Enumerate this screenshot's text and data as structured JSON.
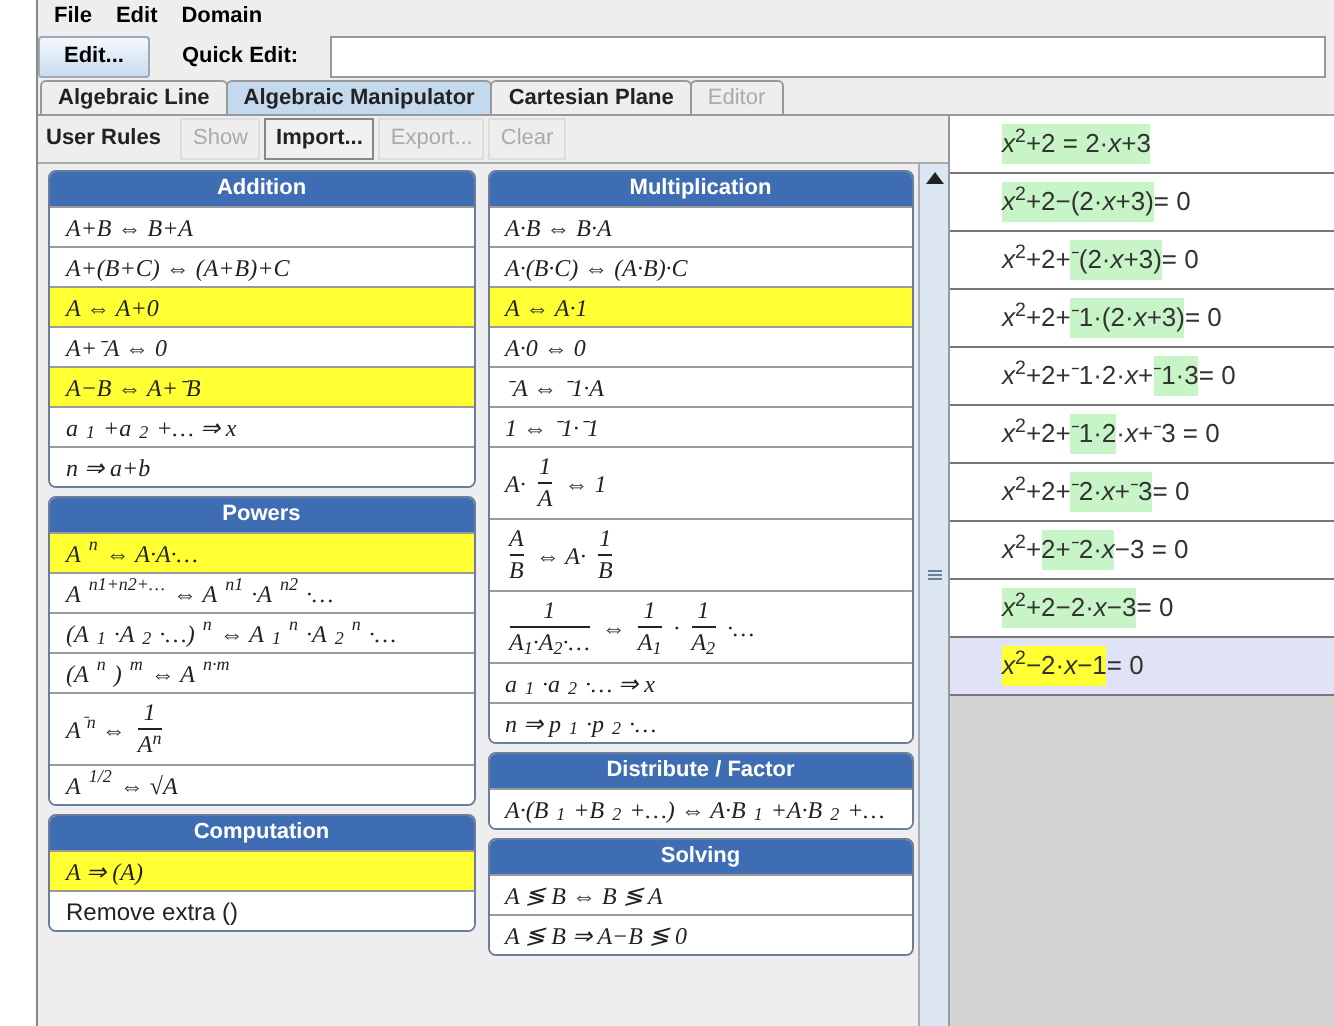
{
  "menu": [
    "File",
    "Edit",
    "Domain"
  ],
  "toolbar": {
    "edit_button": "Edit...",
    "quick_edit_label": "Quick Edit:"
  },
  "tabs": [
    {
      "label": "Algebraic Line",
      "selected": false,
      "disabled": false
    },
    {
      "label": "Algebraic Manipulator",
      "selected": true,
      "disabled": false
    },
    {
      "label": "Cartesian Plane",
      "selected": false,
      "disabled": false
    },
    {
      "label": "Editor",
      "selected": false,
      "disabled": true
    }
  ],
  "rules_toolbar": {
    "label": "User Rules",
    "buttons": [
      {
        "label": "Show",
        "disabled": true
      },
      {
        "label": "Import...",
        "disabled": false
      },
      {
        "label": "Export...",
        "disabled": true
      },
      {
        "label": "Clear",
        "disabled": true
      }
    ]
  },
  "columns": [
    [
      {
        "title": "Addition",
        "rules": [
          {
            "text": "A+B ⇔ B+A",
            "highlighted": false
          },
          {
            "text": "A+(B+C) ⇔ (A+B)+C",
            "highlighted": false
          },
          {
            "text": "A ⇔ A+0",
            "highlighted": true
          },
          {
            "text": "A+⁻A ⇔ 0",
            "highlighted": false
          },
          {
            "text": "A−B ⇔ A+⁻B",
            "highlighted": true
          },
          {
            "text": "a$_{1}$+a$_{2}$+… ⇒ x",
            "highlighted": false
          },
          {
            "text": "n ⇒ a+b",
            "highlighted": false
          }
        ]
      },
      {
        "title": "Powers",
        "rules": [
          {
            "text": "A$^{n}$ ⇔ A·A·…",
            "highlighted": true
          },
          {
            "text": "A$^{n1+n2+…}$ ⇔ A$^{n1}$·A$^{n2}$·…",
            "highlighted": false
          },
          {
            "text": "(A$_{1}$·A$_{2}$·…)$^{n}$ ⇔ A$_{1}$$^{n}$·A$_{2}$$^{n}$·…",
            "highlighted": false
          },
          {
            "text": "(A$^{n}$)$^{m}$ ⇔ A$^{n·m}$",
            "highlighted": false
          },
          {
            "parts": [
              {
                "kind": "text",
                "text": "A$^{⁻n}$ ⇔"
              },
              {
                "kind": "fraction",
                "num": "1",
                "den": "A$^{n}$"
              }
            ],
            "highlighted": false
          },
          {
            "text": "A$^{1/2}$ ⇔ √A",
            "highlighted": false
          }
        ]
      },
      {
        "title": "Computation",
        "rules": [
          {
            "text": "A ⇒ (A)",
            "highlighted": true
          },
          {
            "text": "Remove extra ()",
            "highlighted": false,
            "plain": true
          }
        ]
      }
    ],
    [
      {
        "title": "Multiplication",
        "rules": [
          {
            "text": "A·B ⇔ B·A",
            "highlighted": false
          },
          {
            "text": "A·(B·C) ⇔ (A·B)·C",
            "highlighted": false
          },
          {
            "text": "A ⇔ A·1",
            "highlighted": true
          },
          {
            "text": "A·0 ⇔ 0",
            "highlighted": false
          },
          {
            "text": "⁻A ⇔ ⁻1·A",
            "highlighted": false
          },
          {
            "text": "1 ⇔ ⁻1·⁻1",
            "highlighted": false
          },
          {
            "parts": [
              {
                "kind": "text",
                "text": "A·"
              },
              {
                "kind": "fraction",
                "num": "1",
                "den": "A"
              },
              {
                "kind": "text",
                "text": "⇔ 1"
              }
            ],
            "highlighted": false
          },
          {
            "parts": [
              {
                "kind": "fraction",
                "num": "A",
                "den": "B"
              },
              {
                "kind": "text",
                "text": "⇔ A·"
              },
              {
                "kind": "fraction",
                "num": "1",
                "den": "B"
              }
            ],
            "highlighted": false
          },
          {
            "parts": [
              {
                "kind": "fraction",
                "num": "1",
                "den": "A$_{1}$·A$_{2}$·…"
              },
              {
                "kind": "text",
                "text": "⇔"
              },
              {
                "kind": "fraction",
                "num": "1",
                "den": "A$_{1}$"
              },
              {
                "kind": "text",
                "text": "·"
              },
              {
                "kind": "fraction",
                "num": "1",
                "den": "A$_{2}$"
              },
              {
                "kind": "text",
                "text": "·…"
              }
            ],
            "highlighted": false
          },
          {
            "text": "a$_{1}$·a$_{2}$·… ⇒ x",
            "highlighted": false
          },
          {
            "text": "n ⇒ p$_{1}$·p$_{2}$·…",
            "highlighted": false
          }
        ]
      },
      {
        "title": "Distribute / Factor",
        "rules": [
          {
            "text": "A·(B$_{1}$+B$_{2}$+…) ⇔ A·B$_{1}$+A·B$_{2}$+…",
            "highlighted": false
          }
        ]
      },
      {
        "title": "Solving",
        "rules": [
          {
            "text": "A ≶ B ⇔ B ≶ A",
            "highlighted": false
          },
          {
            "text": "A ≶ B ⇒ A−B ≶ 0",
            "highlighted": false
          }
        ]
      }
    ]
  ],
  "steps": [
    {
      "selected": false,
      "segments": [
        {
          "text": "*x*$^{2}$+2 = 2·*x*+3",
          "highlighted": true
        }
      ]
    },
    {
      "selected": false,
      "segments": [
        {
          "text": "*x*$^{2}$+2−(2·*x*+3)",
          "highlighted": true
        },
        {
          "text": " = 0",
          "highlighted": false
        }
      ]
    },
    {
      "selected": false,
      "segments": [
        {
          "text": "*x*$^{2}$+2+",
          "highlighted": false
        },
        {
          "text": "⁻(2·*x*+3)",
          "highlighted": true
        },
        {
          "text": " = 0",
          "highlighted": false
        }
      ]
    },
    {
      "selected": false,
      "segments": [
        {
          "text": "*x*$^{2}$+2+",
          "highlighted": false
        },
        {
          "text": "⁻1·(2·*x*+3)",
          "highlighted": true
        },
        {
          "text": " = 0",
          "highlighted": false
        }
      ]
    },
    {
      "selected": false,
      "segments": [
        {
          "text": "*x*$^{2}$+2+⁻1·2·*x*+",
          "highlighted": false
        },
        {
          "text": "⁻1·3",
          "highlighted": true
        },
        {
          "text": " = 0",
          "highlighted": false
        }
      ]
    },
    {
      "selected": false,
      "segments": [
        {
          "text": "*x*$^{2}$+2+",
          "highlighted": false
        },
        {
          "text": "⁻1·2",
          "highlighted": true
        },
        {
          "text": "·*x*+⁻3 = 0",
          "highlighted": false
        }
      ]
    },
    {
      "selected": false,
      "segments": [
        {
          "text": "*x*$^{2}$+2+",
          "highlighted": false
        },
        {
          "text": "⁻2·*x*+⁻3",
          "highlighted": true
        },
        {
          "text": " = 0",
          "highlighted": false
        }
      ]
    },
    {
      "selected": false,
      "segments": [
        {
          "text": "*x*$^{2}$+",
          "highlighted": false
        },
        {
          "text": "2+⁻2·*x*",
          "highlighted": true
        },
        {
          "text": "−3 = 0",
          "highlighted": false
        }
      ]
    },
    {
      "selected": false,
      "segments": [
        {
          "text": "*x*$^{2}$+2−2·*x*−3",
          "highlighted": true
        },
        {
          "text": " = 0",
          "highlighted": false
        }
      ]
    },
    {
      "selected": true,
      "segments": [
        {
          "text": "*x*$^{2}$−2·*x*−1",
          "highlighted": true
        },
        {
          "text": " = 0",
          "highlighted": false
        }
      ]
    }
  ]
}
